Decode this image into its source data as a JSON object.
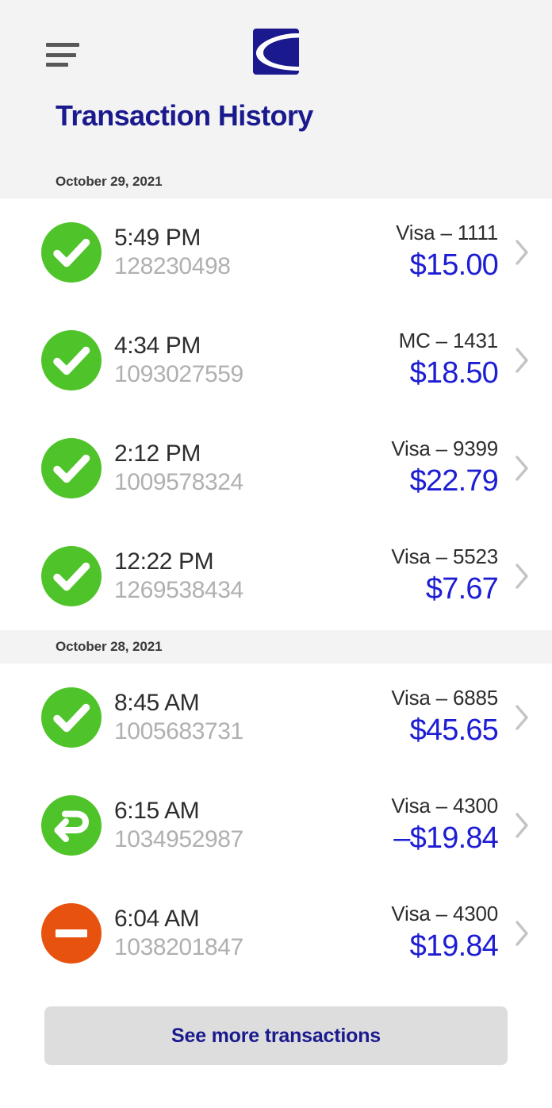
{
  "header": {
    "menu_icon": "hamburger-menu-icon",
    "logo_icon": "elavon-logo-icon",
    "logo_color": "#1a1a8e",
    "title": "Transaction History"
  },
  "colors": {
    "brand_navy": "#1a1a8e",
    "amount_blue": "#1d1dd4",
    "approved_green": "#4fc42a",
    "void_orange": "#e8520f",
    "band_gray": "#f3f3f3",
    "button_gray": "#dddddd",
    "muted_text": "#b0b0b2"
  },
  "sections": [
    {
      "date": "October 29, 2021",
      "transactions": [
        {
          "status": "approved",
          "status_icon": "check-circle-icon",
          "time": "5:49 PM",
          "id": "128230498",
          "card": "Visa – 1111",
          "amount": "$15.00",
          "chevron_icon": "chevron-right-icon"
        },
        {
          "status": "approved",
          "status_icon": "check-circle-icon",
          "time": "4:34 PM",
          "id": "1093027559",
          "card": "MC – 1431",
          "amount": "$18.50",
          "chevron_icon": "chevron-right-icon"
        },
        {
          "status": "approved",
          "status_icon": "check-circle-icon",
          "time": "2:12 PM",
          "id": "1009578324",
          "card": "Visa – 9399",
          "amount": "$22.79",
          "chevron_icon": "chevron-right-icon"
        },
        {
          "status": "approved",
          "status_icon": "check-circle-icon",
          "time": "12:22 PM",
          "id": "1269538434",
          "card": "Visa – 5523",
          "amount": "$7.67",
          "chevron_icon": "chevron-right-icon"
        }
      ]
    },
    {
      "date": "October 28, 2021",
      "transactions": [
        {
          "status": "approved",
          "status_icon": "check-circle-icon",
          "time": "8:45 AM",
          "id": "1005683731",
          "card": "Visa – 6885",
          "amount": "$45.65",
          "chevron_icon": "chevron-right-icon"
        },
        {
          "status": "refund",
          "status_icon": "return-arrow-circle-icon",
          "time": "6:15 AM",
          "id": "1034952987",
          "card": "Visa – 4300",
          "amount": "–$19.84",
          "chevron_icon": "chevron-right-icon"
        },
        {
          "status": "voided",
          "status_icon": "minus-circle-icon",
          "time": "6:04 AM",
          "id": "1038201847",
          "card": "Visa – 4300",
          "amount": "$19.84",
          "chevron_icon": "chevron-right-icon"
        }
      ]
    }
  ],
  "footer": {
    "see_more_label": "See more transactions"
  }
}
